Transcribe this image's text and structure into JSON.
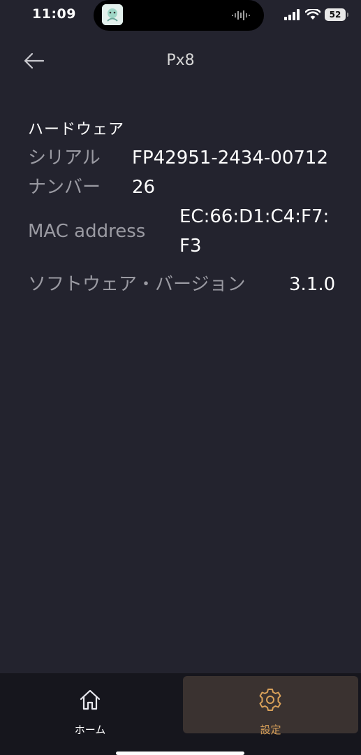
{
  "status_bar": {
    "time": "11:09",
    "battery": "52"
  },
  "header": {
    "title": "Px8",
    "back_icon": "arrow-left-icon"
  },
  "hardware": {
    "section_title": "ハードウェア",
    "rows": [
      {
        "label_line1": "シリアル",
        "label_line2": "ナンバー",
        "value_line1": "FP42951-2434-00712",
        "value_line2": "26"
      },
      {
        "label": "MAC address",
        "value_line1": "EC:66:D1:C4:F7:",
        "value_line2": "F3"
      },
      {
        "label": "ソフトウェア・バージョン",
        "value": "3.1.0"
      }
    ]
  },
  "bottom_nav": {
    "items": [
      {
        "label": "ホーム",
        "icon": "home-icon",
        "selected": false
      },
      {
        "label": "設定",
        "icon": "gear-icon",
        "selected": true
      }
    ]
  },
  "colors": {
    "background": "#23232e",
    "nav_background": "#16161d",
    "selected_tab_background": "#3a3230",
    "accent": "#d9a15a",
    "label_gray": "#9a9aa2"
  }
}
